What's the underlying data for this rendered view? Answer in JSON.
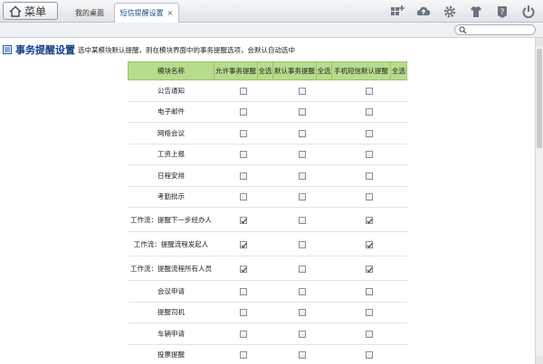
{
  "topbar": {
    "menu_label": "菜单",
    "tabs": [
      {
        "label": "我的桌面"
      },
      {
        "label": "短信提醒设置",
        "close": "×"
      }
    ],
    "tool_icons": [
      "add-shortcut-icon",
      "cloud-icon",
      "settings-icon",
      "shirt-icon",
      "help-icon",
      "power-icon"
    ]
  },
  "search": {
    "placeholder": ""
  },
  "page": {
    "title": "事务提醒设置",
    "description": "选中某模块默认提醒，则在模块界面中的事务提醒选项，会默认自动选中"
  },
  "table": {
    "headers": [
      "模块名称",
      "允许事务提醒",
      "全选",
      "默认事务提醒",
      "全选",
      "手机短信默认提醒",
      "全选"
    ],
    "rows": [
      {
        "name": "公告通知",
        "allow": false,
        "default": false,
        "sms": false
      },
      {
        "name": "电子邮件",
        "allow": false,
        "default": false,
        "sms": false
      },
      {
        "name": "网络会议",
        "allow": false,
        "default": false,
        "sms": false
      },
      {
        "name": "工资上报",
        "allow": false,
        "default": false,
        "sms": false
      },
      {
        "name": "日程安排",
        "allow": false,
        "default": false,
        "sms": false
      },
      {
        "name": "考勤批示",
        "allow": false,
        "default": false,
        "sms": false
      },
      {
        "name": "工作流：提醒下一步经办人",
        "allow": true,
        "default": false,
        "sms": true
      },
      {
        "name": "工作流：提醒流程发起人",
        "allow": true,
        "default": false,
        "sms": true
      },
      {
        "name": "工作流：提醒流程所有人员",
        "allow": true,
        "default": false,
        "sms": true
      },
      {
        "name": "会议申请",
        "allow": false,
        "default": false,
        "sms": false
      },
      {
        "name": "提醒司机",
        "allow": false,
        "default": false,
        "sms": false
      },
      {
        "name": "车辆申请",
        "allow": false,
        "default": false,
        "sms": false
      },
      {
        "name": "投票提醒",
        "allow": false,
        "default": false,
        "sms": false
      }
    ]
  },
  "colors": {
    "header_green": "#b6dd8c",
    "title_blue": "#0f3f86",
    "tab_active_text": "#1a4f8a"
  }
}
